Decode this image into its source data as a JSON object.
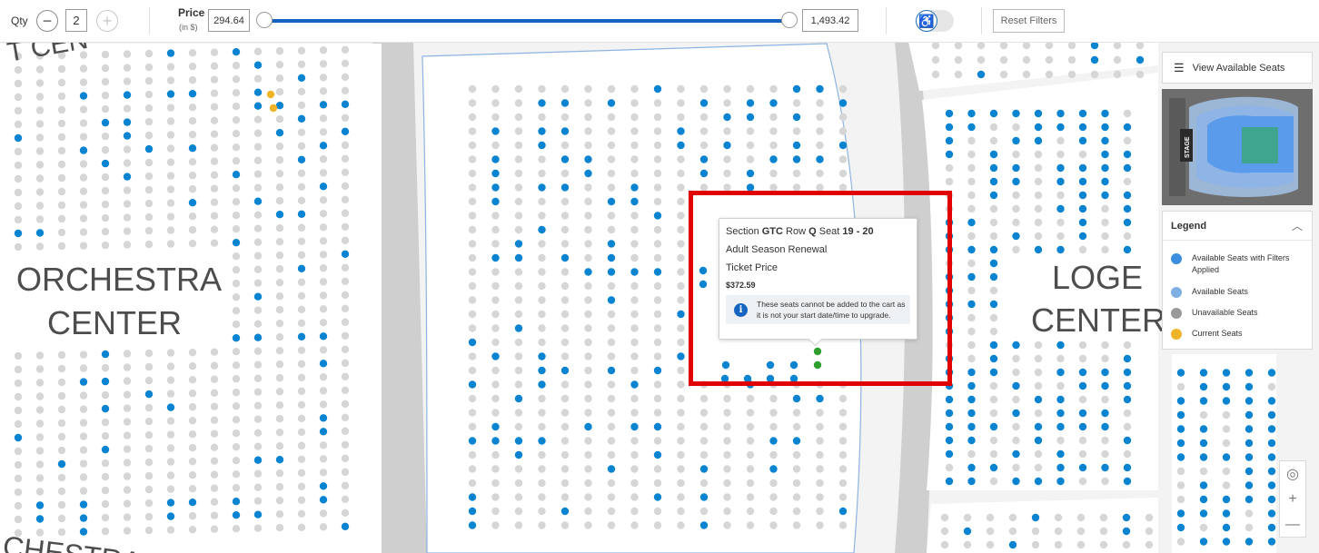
{
  "toolbar": {
    "qty_label": "Qty",
    "qty_minus": "−",
    "qty_value": "2",
    "qty_plus": "+",
    "price_label": "Price",
    "price_unit": "(in $)",
    "price_min": "294.64",
    "price_max": "1,493.42",
    "accessibility_icon": "♿",
    "reset_label": "Reset Filters"
  },
  "map": {
    "sections": {
      "orchestra_center_left": [
        "ORCHESTRA",
        "CENTER"
      ],
      "loge_center": [
        "LOGE",
        "CENTER"
      ],
      "top_left_partial": "T CEN",
      "bottom_left_partial": "CHESTRA"
    }
  },
  "tooltip": {
    "section_prefix": "Section ",
    "section": "GTC",
    "row_prefix": " Row ",
    "row": "Q",
    "seat_prefix": " Seat ",
    "seats": "19 - 20",
    "ticket_type": "Adult Season Renewal",
    "price_label": "Ticket Price",
    "price": "$372.59",
    "info_icon": "i",
    "message": "These seats cannot be added to the cart as it is not your start date/time to upgrade."
  },
  "panel": {
    "view_seats_label": "View Available Seats",
    "minimap_label": "STAGE",
    "legend_title": "Legend",
    "legend_items": [
      {
        "label": "Available Seats with Filters Applied",
        "color": "#3b8ede"
      },
      {
        "label": "Available Seats",
        "color": "#7fb0e4"
      },
      {
        "label": "Unavailable Seats",
        "color": "#9a9a9a"
      },
      {
        "label": "Current Seats",
        "color": "#f0b429"
      }
    ]
  },
  "zoom": {
    "recenter": "◎",
    "zoom_in": "+",
    "zoom_out": "—"
  },
  "colors": {
    "available_filtered": "#0a84d0",
    "unavailable": "#d6d6d6",
    "current": "#f0b429",
    "selected": "#2e9e2e",
    "accent": "#1565c0",
    "highlight": "#e00000"
  }
}
